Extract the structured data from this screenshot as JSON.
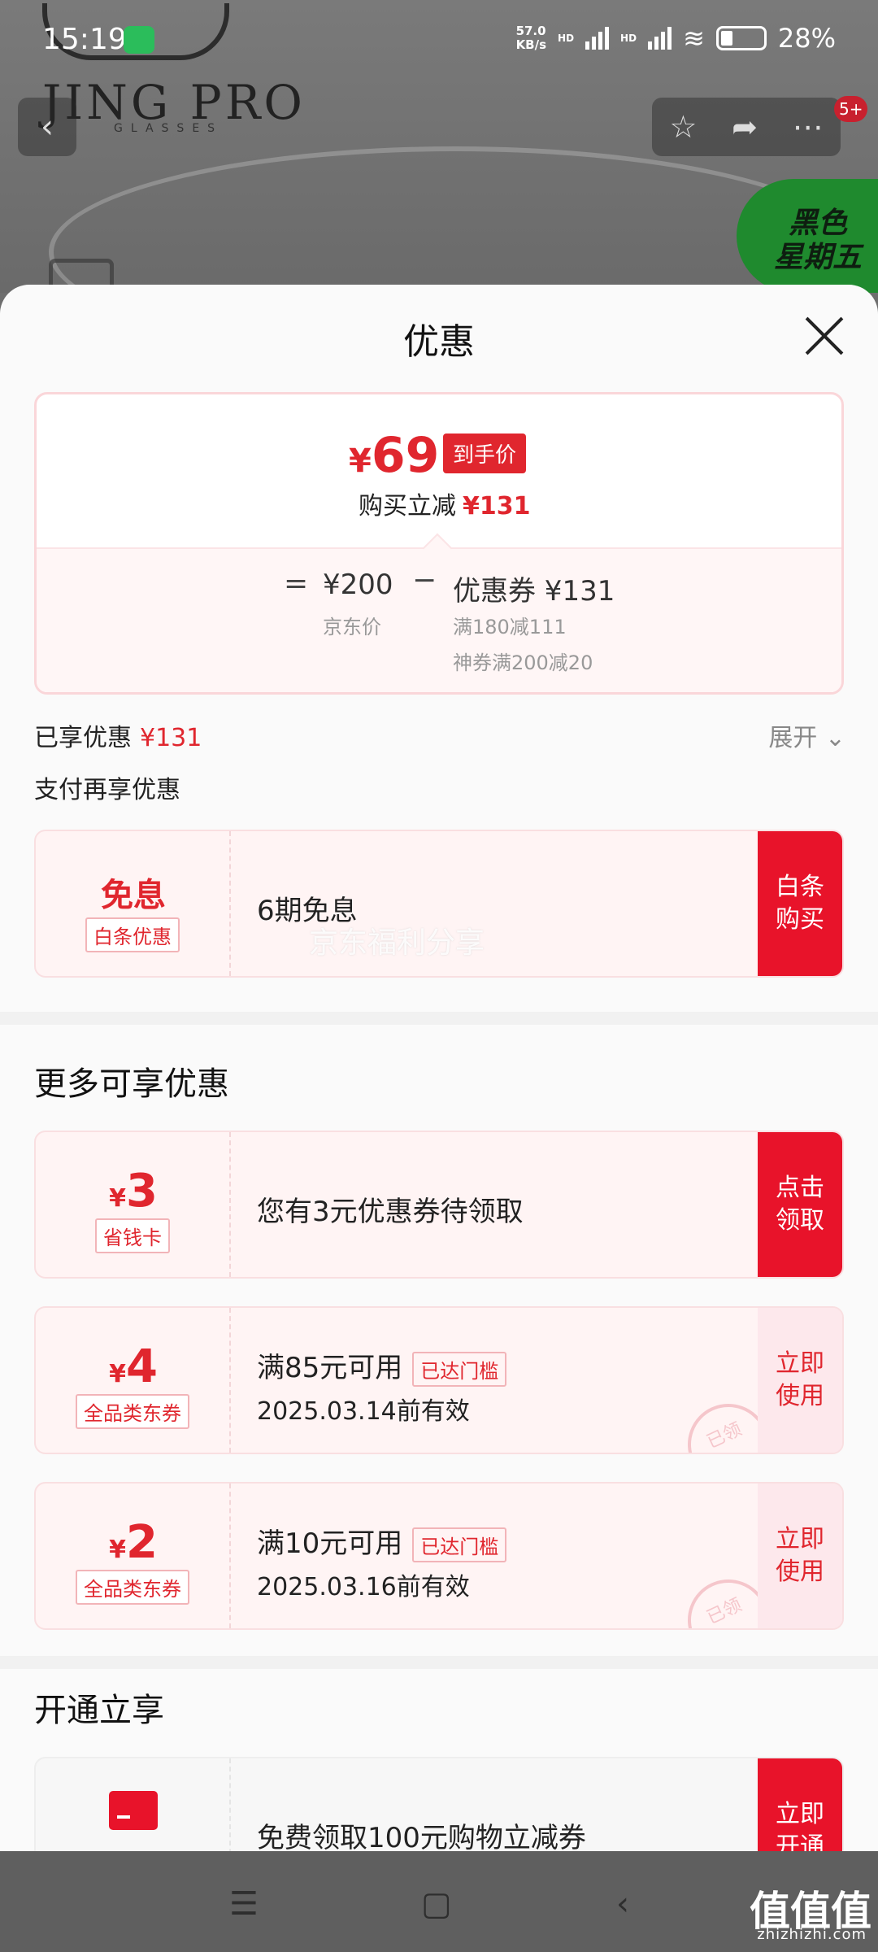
{
  "status_bar": {
    "time": "15:19",
    "net_speed_value": "57.0",
    "net_speed_unit": "KB/s",
    "hd1": "HD",
    "hd2": "HD",
    "battery": "28%"
  },
  "background": {
    "brand": "JING PRO",
    "brand_sub": "GLASSES",
    "promo_tag_line1": "黑色",
    "promo_tag_line2": "星期五",
    "notification_badge": "5+"
  },
  "sheet": {
    "title": "优惠",
    "price_box": {
      "currency": "¥",
      "final_price": "69",
      "final_tag": "到手价",
      "discount_label": "购买立减",
      "discount_value": "¥131",
      "eq": "=",
      "jd_price": "¥200",
      "jd_label": "京东价",
      "minus": "−",
      "coupon_amount": "优惠券 ¥131",
      "coupon_rule1": "满180减111",
      "coupon_rule2": "神券满200减20"
    },
    "enjoyed_label": "已享优惠",
    "enjoyed_value": "¥131",
    "expand_label": "展开",
    "pay_more_label": "支付再享优惠",
    "baitiao_card": {
      "big": "免息",
      "sub": "白条优惠",
      "text": "6期免息",
      "action": "白条\n购买"
    },
    "watermark": "京东福利分享",
    "more_section_title": "更多可享优惠",
    "save_card": {
      "currency": "¥",
      "amount": "3",
      "sub": "省钱卡",
      "text": "您有3元优惠券待领取",
      "action": "点击\n领取"
    },
    "coupons": [
      {
        "currency": "¥",
        "amount": "4",
        "sub": "全品类东券",
        "rule": "满85元可用",
        "threshold": "已达门槛",
        "valid": "2025.03.14前有效",
        "action": "立即\n使用",
        "stamp": "已领"
      },
      {
        "currency": "¥",
        "amount": "2",
        "sub": "全品类东券",
        "rule": "满10元可用",
        "threshold": "已达门槛",
        "valid": "2025.03.16前有效",
        "action": "立即\n使用",
        "stamp": "已领"
      }
    ],
    "open_section_title": "开通立享",
    "open_card": {
      "text": "免费领取100元购物立减券",
      "action": "立即\n开通"
    }
  },
  "footer": {
    "logo": "值值值",
    "site": "zhizhizhi.com"
  }
}
